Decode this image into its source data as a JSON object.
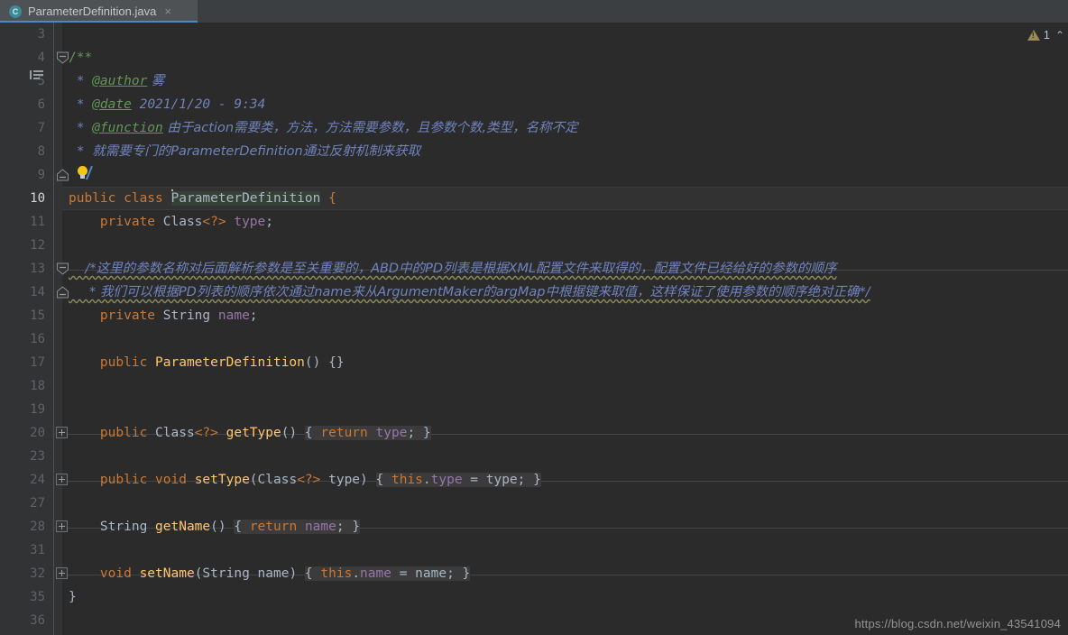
{
  "window": {
    "tab": {
      "icon": "java-class-icon",
      "filename": "ParameterDefinition.java",
      "close": "×"
    }
  },
  "inspection": {
    "warning_icon": "warning-triangle-icon",
    "warning_count": "1",
    "chevron": "⌃"
  },
  "watermark": "https://blog.csdn.net/weixin_43541094",
  "editor": {
    "language": "java",
    "current_line": 10,
    "lines": [
      {
        "no": "3",
        "text": ""
      },
      {
        "no": "4",
        "text": "/**"
      },
      {
        "no": "5",
        "text": " * @author 雾"
      },
      {
        "no": "6",
        "text": " * @date 2021/1/20 - 9:34"
      },
      {
        "no": "7",
        "text": " * @function 由于action需要类，方法，方法需要参数，且参数个数,类型，名称不定"
      },
      {
        "no": "8",
        "text": " * 就需要专门的ParameterDefinition通过反射机制来获取"
      },
      {
        "no": "9",
        "text": " */"
      },
      {
        "no": "10",
        "text": "public class ParameterDefinition {"
      },
      {
        "no": "11",
        "text": "    private Class<?> type;"
      },
      {
        "no": "12",
        "text": ""
      },
      {
        "no": "13",
        "text": "    /*这里的参数名称对后面解析参数是至关重要的，ABD中的PD列表是根据XML配置文件来取得的，配置文件已经给好的参数的顺序"
      },
      {
        "no": "14",
        "text": "     * 我们可以根据PD列表的顺序依次通过name来从ArgumentMaker的argMap中根据键来取值，这样保证了使用参数的顺序绝对正确*/"
      },
      {
        "no": "15",
        "text": "    private String name;"
      },
      {
        "no": "16",
        "text": ""
      },
      {
        "no": "17",
        "text": "    public ParameterDefinition() {}"
      },
      {
        "no": "18",
        "text": ""
      },
      {
        "no": "19",
        "text": ""
      },
      {
        "no": "20",
        "text": "    public Class<?> getType() { return type; }"
      },
      {
        "no": "23",
        "text": ""
      },
      {
        "no": "24",
        "text": "    public void setType(Class<?> type) { this.type = type; }"
      },
      {
        "no": "27",
        "text": ""
      },
      {
        "no": "28",
        "text": "    String getName() { return name; }"
      },
      {
        "no": "31",
        "text": ""
      },
      {
        "no": "32",
        "text": "    void setName(String name) { this.name = name; }"
      },
      {
        "no": "35",
        "text": "}"
      },
      {
        "no": "36",
        "text": ""
      }
    ],
    "gutter_icons": {
      "javadoc_fold_line": "4",
      "javadoc_fold_end_line": "9",
      "comment_fold_line": "13",
      "comment_fold_end_line": "14",
      "collapsed_fold_lines": [
        "20",
        "24",
        "28",
        "32"
      ],
      "intention_bulb_line": "9"
    },
    "colors": {
      "background": "#2b2b2b",
      "gutter": "#313335",
      "keyword": "#cc7832",
      "method": "#ffc66d",
      "field": "#9876aa",
      "doc_comment": "#6f83be",
      "doc_tag": "#629755",
      "text": "#a9b7c6",
      "tab_active_underline": "#4a88c7",
      "current_line": "#323232",
      "selection": "#344134",
      "typo_wave": "#8a8a5c"
    }
  }
}
